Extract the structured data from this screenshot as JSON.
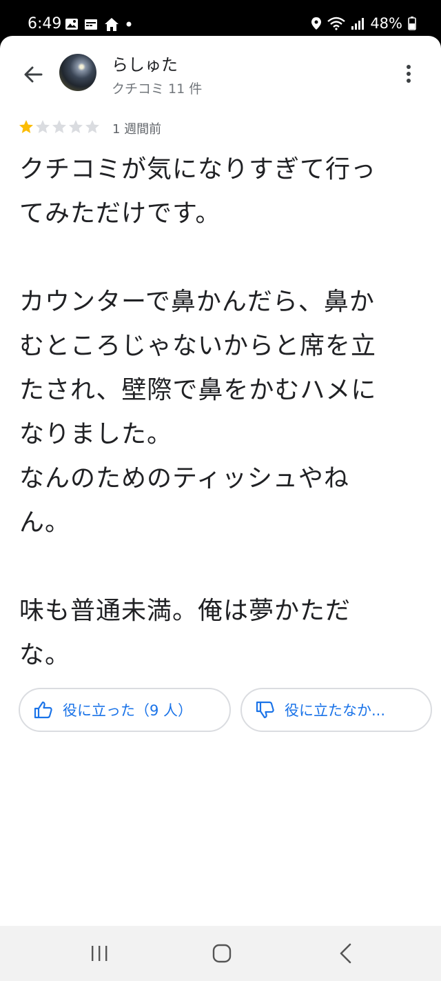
{
  "status_bar": {
    "time": "6:49",
    "left_icons": [
      "image-icon",
      "calendar-icon",
      "home-icon",
      "dot-icon"
    ],
    "right_icons": [
      "location-icon",
      "wifi-icon",
      "signal-icon"
    ],
    "battery": "48%"
  },
  "header": {
    "user_name": "らしゅた",
    "review_count": "クチコミ 11 件"
  },
  "review": {
    "rating": 1,
    "max_rating": 5,
    "time_ago": "1 週間前",
    "text": "クチコミが気になりすぎて行っ\nてみただけです。\n\nカウンターで鼻かんだら、鼻か\nむところじゃないからと席を立\nたされ、壁際で鼻をかむハメに\nなりました。\nなんのためのティッシュやね\nん。\n\n味も普通未満。俺は夢かただ\nな。"
  },
  "actions": {
    "helpful_label": "役に立った（9 人）",
    "not_helpful_label": "役に立たなか..."
  },
  "colors": {
    "accent": "#1a73e8",
    "star_filled": "#fbbc04",
    "star_empty": "#dadce0"
  },
  "nav": [
    "recents-button",
    "home-button",
    "back-button"
  ]
}
